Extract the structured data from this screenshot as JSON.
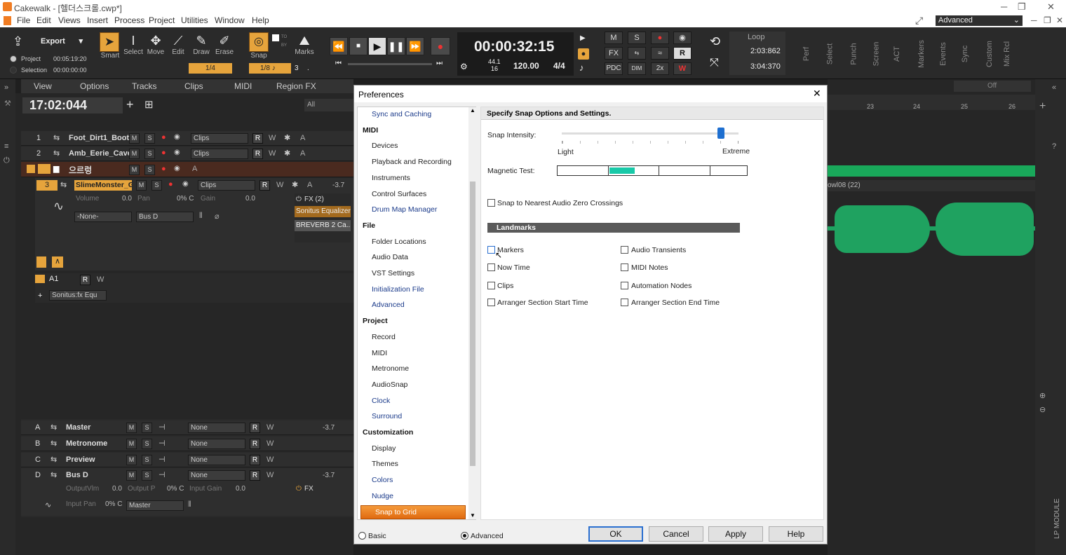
{
  "app": {
    "title": "Cakewalk - [헬더스크롤.cwp*]",
    "layout_preset": "Advanced"
  },
  "menu": [
    "File",
    "Edit",
    "Views",
    "Insert",
    "Process",
    "Project",
    "Utilities",
    "Window",
    "Help"
  ],
  "toolbar": {
    "export_label": "Export",
    "project_label": "Project",
    "project_time": "00:05:19:20",
    "selection_label": "Selection",
    "selection_time": "00:00:00:00",
    "tools": [
      "Smart",
      "Select",
      "Move",
      "Edit",
      "Draw",
      "Erase"
    ],
    "draw_res": "1/4",
    "snap_label": "Snap",
    "snap_res": "1/8",
    "snap_num": "3",
    "snap_dot": ".",
    "marks_label": "Marks",
    "to_label": "TO",
    "by_label": "BY",
    "time": "00:00:32:15",
    "sample_rate_top": "44.1",
    "sample_rate_bot": "16",
    "tempo": "120.00",
    "meter": "4/4",
    "mix_buttons": [
      "M",
      "S",
      "FX",
      "PDC",
      "DIM",
      "2x"
    ],
    "loop_label": "Loop",
    "loop_start": "2:03:862",
    "loop_end": "3:04:370",
    "right_modules": [
      "Perf",
      "Select",
      "Punch",
      "Screen",
      "ACT",
      "Markers",
      "Events",
      "Sync",
      "Custom",
      "Mix Rcl"
    ]
  },
  "subtoolbar": {
    "items": [
      "View",
      "Options",
      "Tracks",
      "Clips",
      "MIDI",
      "Region FX"
    ],
    "now": "17:02:044",
    "filter": "All",
    "off_label": "Off"
  },
  "tracks": [
    {
      "num": "1",
      "name": "Foot_Dirt1_Boot",
      "mode": "Clips"
    },
    {
      "num": "2",
      "name": "Amb_Eerie_Cave",
      "mode": "Clips"
    },
    {
      "num": "",
      "name": "으르렁",
      "mode": ""
    },
    {
      "num": "3",
      "name": "SlimeMonster_G",
      "mode": "Clips",
      "vol": "-3.7"
    }
  ],
  "track3": {
    "volume_label": "Volume",
    "volume": "0.0",
    "pan_label": "Pan",
    "pan": "0% C",
    "gain_label": "Gain",
    "gain": "0.0",
    "input": "-None-",
    "output": "Bus D",
    "fx_label": "FX (2)",
    "fx1": "Sonitus Equalizer",
    "fx2": "BREVERB 2 Ca..."
  },
  "automation": {
    "lane": "A1",
    "param": "Sonitus:fx Equ"
  },
  "buses": [
    {
      "letter": "A",
      "name": "Master",
      "out": "None",
      "vol": "-3.7"
    },
    {
      "letter": "B",
      "name": "Metronome",
      "out": "None",
      "vol": ""
    },
    {
      "letter": "C",
      "name": "Preview",
      "out": "None",
      "vol": ""
    },
    {
      "letter": "D",
      "name": "Bus D",
      "out": "None",
      "vol": "-3.7"
    }
  ],
  "busd": {
    "outvol_label": "OutputVlm",
    "outvol": "0.0",
    "outpan_label": "Output P",
    "outpan": "0% C",
    "ingain_label": "Input Gain",
    "ingain": "0.0",
    "inpan_label": "Input Pan",
    "inpan": "0% C",
    "master": "Master",
    "fx": "FX"
  },
  "timeline": {
    "ticks": [
      "23",
      "24",
      "25",
      "26"
    ],
    "clip_label": "owl08 (22)"
  },
  "right_side_label": "LP MODULE",
  "dialog": {
    "title": "Preferences",
    "nav": [
      {
        "type": "item",
        "label": "Sync and Caching",
        "blue": true
      },
      {
        "type": "head",
        "label": "MIDI"
      },
      {
        "type": "item",
        "label": "Devices"
      },
      {
        "type": "item",
        "label": "Playback and Recording"
      },
      {
        "type": "item",
        "label": "Instruments"
      },
      {
        "type": "item",
        "label": "Control Surfaces"
      },
      {
        "type": "item",
        "label": "Drum Map Manager",
        "blue": true
      },
      {
        "type": "head",
        "label": "File"
      },
      {
        "type": "item",
        "label": "Folder Locations"
      },
      {
        "type": "item",
        "label": "Audio Data"
      },
      {
        "type": "item",
        "label": "VST Settings"
      },
      {
        "type": "item",
        "label": "Initialization File",
        "blue": true
      },
      {
        "type": "item",
        "label": "Advanced",
        "blue": true
      },
      {
        "type": "head",
        "label": "Project"
      },
      {
        "type": "item",
        "label": "Record"
      },
      {
        "type": "item",
        "label": "MIDI"
      },
      {
        "type": "item",
        "label": "Metronome"
      },
      {
        "type": "item",
        "label": "AudioSnap"
      },
      {
        "type": "item",
        "label": "Clock",
        "blue": true
      },
      {
        "type": "item",
        "label": "Surround",
        "blue": true
      },
      {
        "type": "head",
        "label": "Customization"
      },
      {
        "type": "item",
        "label": "Display"
      },
      {
        "type": "item",
        "label": "Themes"
      },
      {
        "type": "item",
        "label": "Colors",
        "blue": true
      },
      {
        "type": "item",
        "label": "Nudge",
        "blue": true
      }
    ],
    "selected": "Snap to Grid",
    "heading": "Specify Snap Options and Settings.",
    "snap_intensity_label": "Snap Intensity:",
    "snap_intensity": 0.9,
    "light_label": "Light",
    "extreme_label": "Extreme",
    "magnetic_label": "Magnetic Test:",
    "zero_cross_label": "Snap to Nearest Audio Zero Crossings",
    "landmarks_label": "Landmarks",
    "landmarks_left": [
      "Markers",
      "Now Time",
      "Clips",
      "Arranger Section Start Time"
    ],
    "landmarks_right": [
      "Audio Transients",
      "MIDI Notes",
      "Automation Nodes",
      "Arranger Section End Time"
    ],
    "basic_label": "Basic",
    "advanced_label": "Advanced",
    "buttons": [
      "OK",
      "Cancel",
      "Apply",
      "Help"
    ]
  }
}
